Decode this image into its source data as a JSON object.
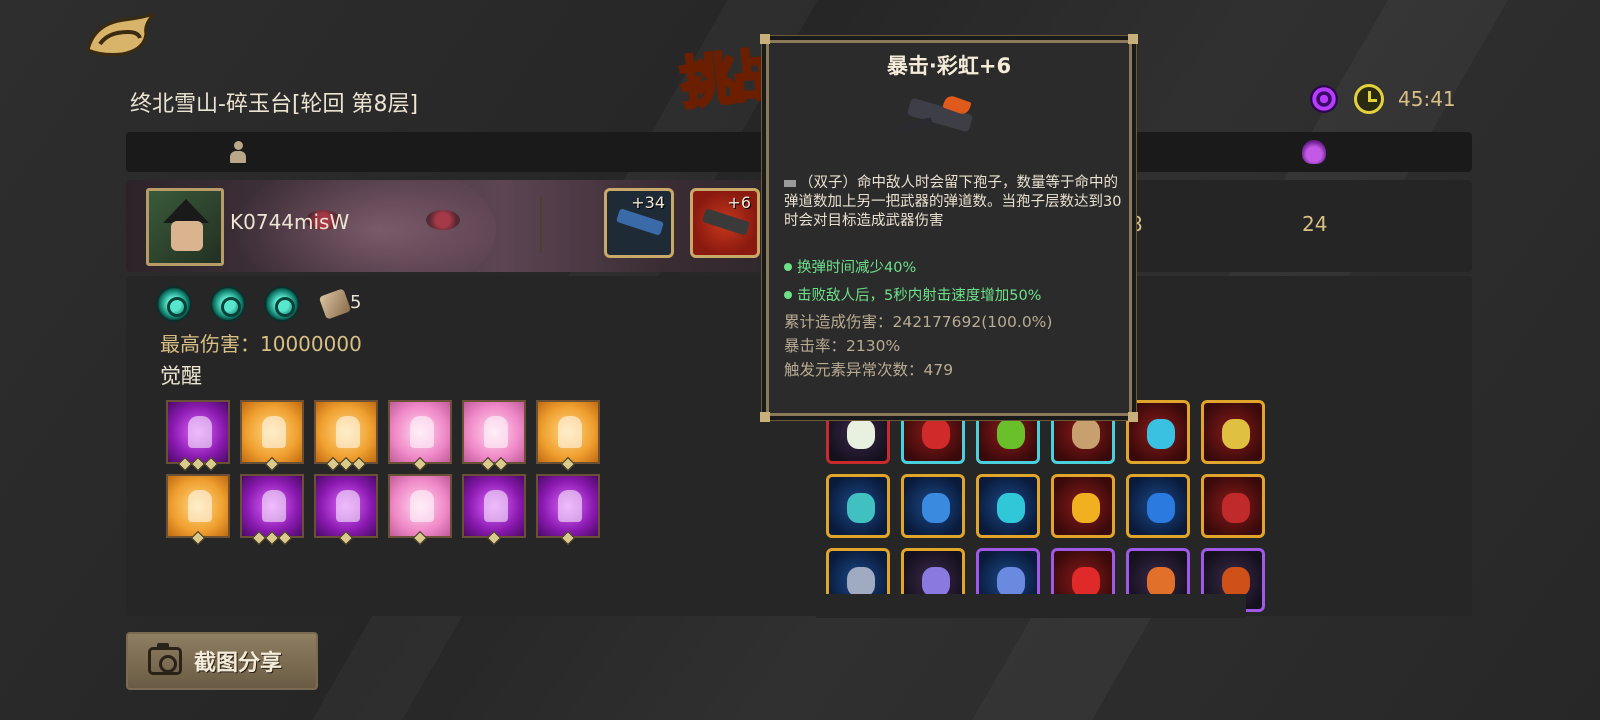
{
  "header": {
    "stage_title": "终北雪山-碎玉台[轮回  第8层]",
    "timer": "45:41",
    "title_logo_text": "挑战"
  },
  "player": {
    "name": "K0744misW",
    "weapons": [
      {
        "level": "+34",
        "icon": "blue-pistol-icon"
      },
      {
        "level": "+6",
        "icon": "rainbow-crossbow-icon"
      }
    ],
    "stat_a": "8",
    "stat_b": "24"
  },
  "detail": {
    "scroll_count": "5",
    "max_damage_label": "最高伤害：10000000",
    "awaken_label": "觉醒",
    "awakenings": [
      {
        "color": "purple",
        "stars": 3
      },
      {
        "color": "orange",
        "stars": 1
      },
      {
        "color": "orange",
        "stars": 3
      },
      {
        "color": "pink",
        "stars": 1
      },
      {
        "color": "pink",
        "stars": 2
      },
      {
        "color": "orange",
        "stars": 1
      },
      {
        "color": "orange",
        "stars": 1
      },
      {
        "color": "purple",
        "stars": 3
      },
      {
        "color": "purple",
        "stars": 1
      },
      {
        "color": "pink",
        "stars": 1
      },
      {
        "color": "purple",
        "stars": 1
      },
      {
        "color": "purple",
        "stars": 1
      }
    ],
    "items": [
      {
        "border": "b-red",
        "bg": "bg-d",
        "gem": "#e8f0e0"
      },
      {
        "border": "b-cyan",
        "bg": "bg-r",
        "gem": "#d02a2a"
      },
      {
        "border": "b-cyan",
        "bg": "bg-r",
        "gem": "#6ac02a"
      },
      {
        "border": "b-cyan",
        "bg": "bg-r",
        "gem": "#c8a070"
      },
      {
        "border": "",
        "bg": "bg-r",
        "gem": "#3ac0e0"
      },
      {
        "border": "",
        "bg": "bg-r",
        "gem": "#e0c040"
      },
      {
        "border": "",
        "bg": "bg-b",
        "gem": "#40c0c0"
      },
      {
        "border": "",
        "bg": "bg-b",
        "gem": "#3a8ae0"
      },
      {
        "border": "",
        "bg": "bg-b",
        "gem": "#30c8d8"
      },
      {
        "border": "",
        "bg": "bg-r",
        "gem": "#f0b020"
      },
      {
        "border": "",
        "bg": "bg-b",
        "gem": "#2a7ae0"
      },
      {
        "border": "",
        "bg": "bg-r",
        "gem": "#c02a2a"
      },
      {
        "border": "",
        "bg": "bg-b",
        "gem": "#a0aac0"
      },
      {
        "border": "",
        "bg": "bg-d",
        "gem": "#8a7ae0"
      },
      {
        "border": "b-purple",
        "bg": "bg-b",
        "gem": "#6a8ae0"
      },
      {
        "border": "b-purple",
        "bg": "bg-r",
        "gem": "#e02a2a"
      },
      {
        "border": "b-purple",
        "bg": "bg-d",
        "gem": "#e0702a"
      },
      {
        "border": "b-purple",
        "bg": "bg-d",
        "gem": "#d0501a"
      }
    ]
  },
  "tooltip": {
    "title": "暴击·彩虹+6",
    "description": "（双子）命中敌人时会留下孢子，数量等于命中的弹道数加上另一把武器的弹道数。当孢子层数达到30时会对目标造成武器伤害",
    "bonus_1": "换弹时间减少40%",
    "bonus_2": "击败敌人后，5秒内射击速度增加50%",
    "total_damage": "累计造成伤害：242177692(100.0%)",
    "crit_rate": "暴击率：2130%",
    "element_count": "触发元素异常次数：479"
  },
  "share_button": {
    "label": "截图分享"
  }
}
